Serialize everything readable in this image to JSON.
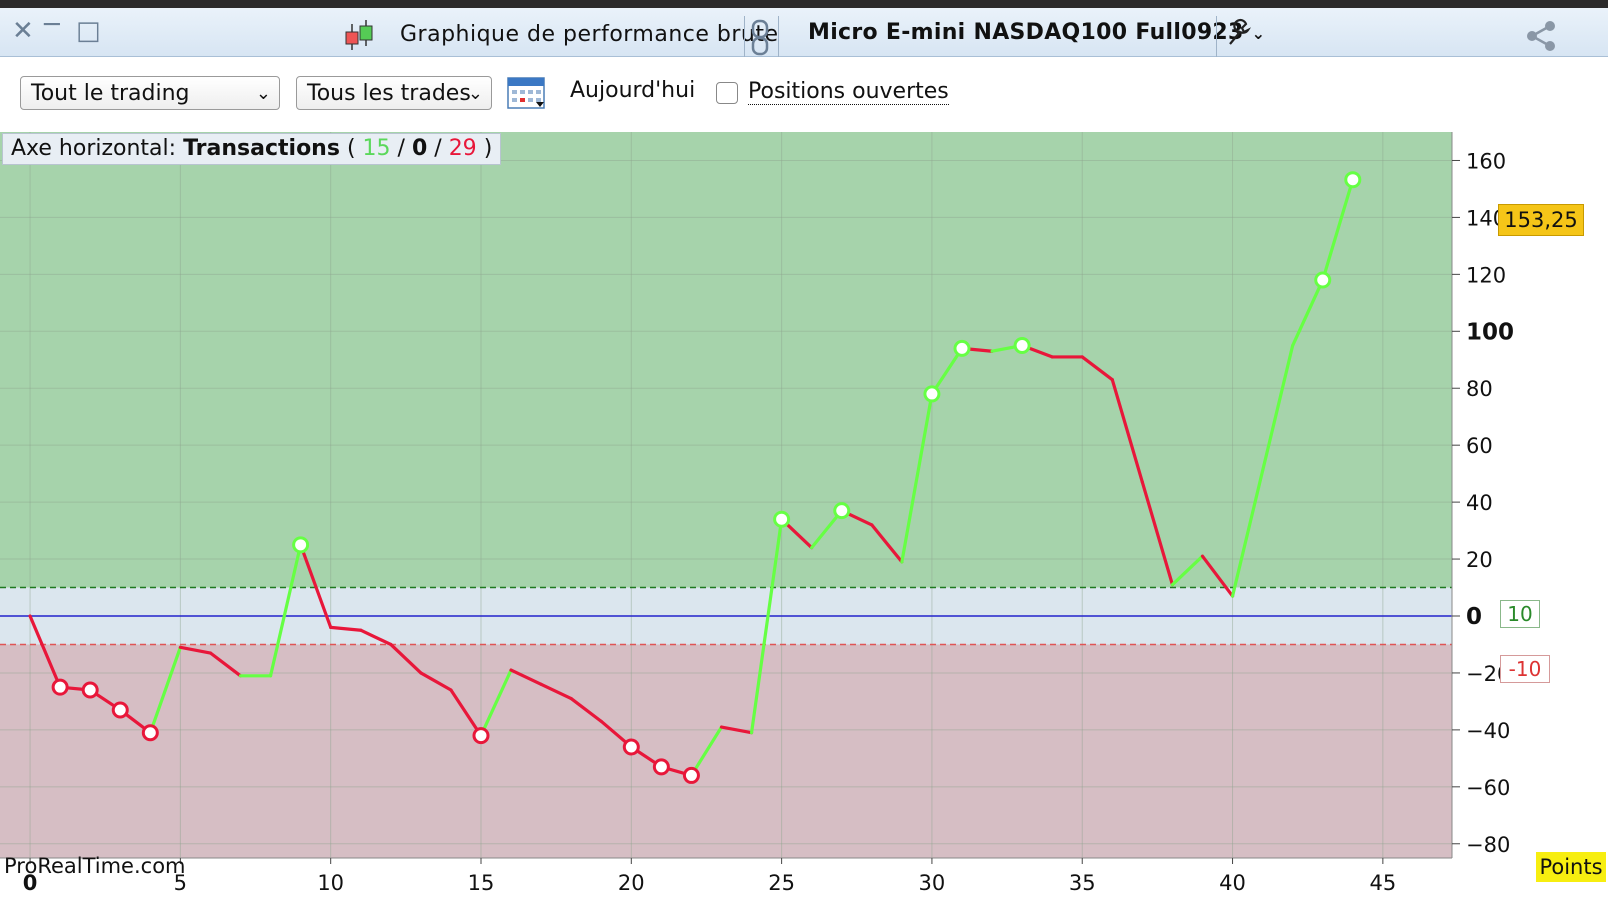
{
  "titlebar": {
    "title": "Graphique de performance brute",
    "instrument": "Micro E-mini NASDAQ100 Full0923"
  },
  "toolbar": {
    "scope_select": "Tout le trading",
    "trades_select": "Tous les trades",
    "date_label": "Aujourd'hui",
    "open_positions_label": "Positions ouvertes"
  },
  "legend": {
    "prefix": "Axe horizontal:",
    "mode": "Transactions",
    "open_paren": "(",
    "wins": "15",
    "sep1": "/",
    "neutral": "0",
    "sep2": "/",
    "losses": "29",
    "close_paren": ")"
  },
  "watermark": "ProRealTime.com",
  "last_value_tag": "153,25",
  "threshold_upper_label": "10",
  "threshold_lower_label": "-10",
  "units_label": "Points",
  "colors": {
    "win": "#66ff44",
    "loss": "#e8173a",
    "zero_line": "#2222cc",
    "profit_zone": "#a6d3ab",
    "loss_zone": "#d6bec4",
    "neutral_zone": "#dbe6ee"
  },
  "chart_data": {
    "type": "line",
    "x_ticks": [
      0,
      5,
      10,
      15,
      20,
      25,
      30,
      35,
      40,
      45
    ],
    "y_ticks": [
      -80,
      -60,
      -40,
      -20,
      0,
      20,
      40,
      60,
      80,
      100,
      120,
      140,
      160
    ],
    "ylim": [
      -85,
      170
    ],
    "xlim": [
      -1,
      47.3
    ],
    "thresholds": [
      10,
      -10
    ],
    "x": [
      0,
      1,
      2,
      3,
      4,
      5,
      6,
      7,
      8,
      9,
      10,
      11,
      12,
      13,
      14,
      15,
      16,
      17,
      18,
      19,
      20,
      21,
      22,
      23,
      24,
      25,
      26,
      27,
      28,
      29,
      30,
      31,
      32,
      33,
      34,
      35,
      36,
      37,
      38,
      39,
      40,
      41,
      42,
      43,
      44
    ],
    "y": [
      0,
      -25,
      -26,
      -33,
      -41,
      -11,
      -13,
      -21,
      -21,
      25,
      -4,
      -5,
      -10,
      -20,
      -26,
      -42,
      -19,
      -24,
      -29,
      -37,
      -46,
      -53,
      -56,
      -39,
      -41,
      34,
      24,
      37,
      32,
      19,
      78,
      94,
      93,
      95,
      91,
      91,
      83,
      47,
      11,
      21,
      7,
      51,
      95,
      118,
      153.25
    ],
    "segment_colors": [
      "loss",
      "loss",
      "loss",
      "loss",
      "win",
      "loss",
      "loss",
      "win",
      "win",
      "loss",
      "loss",
      "loss",
      "loss",
      "loss",
      "loss",
      "win",
      "loss",
      "loss",
      "loss",
      "loss",
      "loss",
      "loss",
      "win",
      "loss",
      "win",
      "loss",
      "win",
      "loss",
      "loss",
      "win",
      "win",
      "loss",
      "win",
      "loss",
      "loss",
      "loss",
      "loss",
      "loss",
      "win",
      "loss",
      "win",
      "win",
      "win",
      "win"
    ],
    "markers": [
      {
        "x": 1,
        "y": -25,
        "color": "loss"
      },
      {
        "x": 2,
        "y": -26,
        "color": "loss"
      },
      {
        "x": 3,
        "y": -33,
        "color": "loss"
      },
      {
        "x": 4,
        "y": -41,
        "color": "loss"
      },
      {
        "x": 9,
        "y": 25,
        "color": "win"
      },
      {
        "x": 15,
        "y": -42,
        "color": "loss"
      },
      {
        "x": 20,
        "y": -46,
        "color": "loss"
      },
      {
        "x": 21,
        "y": -53,
        "color": "loss"
      },
      {
        "x": 22,
        "y": -56,
        "color": "loss"
      },
      {
        "x": 25,
        "y": 34,
        "color": "win"
      },
      {
        "x": 27,
        "y": 37,
        "color": "win"
      },
      {
        "x": 30,
        "y": 78,
        "color": "win"
      },
      {
        "x": 31,
        "y": 94,
        "color": "win"
      },
      {
        "x": 33,
        "y": 95,
        "color": "win"
      },
      {
        "x": 43,
        "y": 118,
        "color": "win"
      },
      {
        "x": 44,
        "y": 153.25,
        "color": "win"
      }
    ]
  }
}
